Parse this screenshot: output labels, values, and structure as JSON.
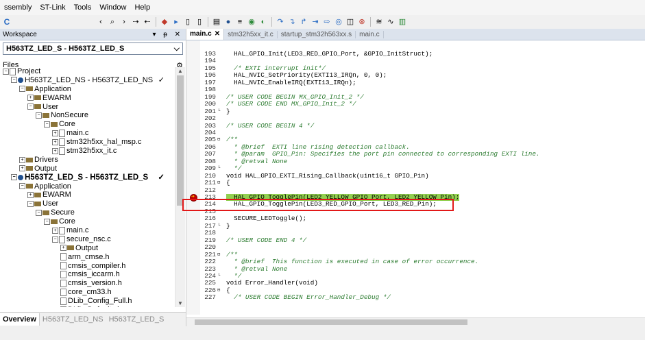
{
  "menu": [
    "ssembly",
    "ST-Link",
    "Tools",
    "Window",
    "Help"
  ],
  "toolbar": {
    "app_icon": "C",
    "icons": [
      "chevron-left-icon",
      "search-icon",
      "chevron-right-icon",
      "bookmark-next-icon",
      "bookmark-prev-icon",
      "stop-icon",
      "run-icon",
      "file-icon",
      "file-icon",
      "compile-icon",
      "build-icon",
      "build-all-icon",
      "make-icon",
      "debug-icon",
      "step-over-icon",
      "step-into-icon",
      "step-out-icon",
      "next-stmt-icon",
      "run-to-cursor-icon",
      "reset-icon",
      "break-icon",
      "stop-debug-icon",
      "etm-icon",
      "swo-icon",
      "chart-icon"
    ]
  },
  "workspace": {
    "title": "Workspace",
    "header_controls": "▾ ᵽ ✕",
    "selected_config": "H563TZ_LED_S - H563TZ_LED_S",
    "files_label": "Files",
    "tree": [
      {
        "indent": 0,
        "prefix": "⊟",
        "icon": "file",
        "label": "Project"
      },
      {
        "indent": 1,
        "prefix": "⊟",
        "icon": "proj",
        "label": "H563TZ_LED_NS - H563TZ_LED_NS",
        "check": "✓"
      },
      {
        "indent": 2,
        "prefix": "⊟",
        "icon": "folder",
        "label": "Application"
      },
      {
        "indent": 3,
        "prefix": "⊞",
        "icon": "folder",
        "label": "EWARM"
      },
      {
        "indent": 3,
        "prefix": "⊟",
        "icon": "folder",
        "label": "User"
      },
      {
        "indent": 4,
        "prefix": "⊟",
        "icon": "folder",
        "label": "NonSecure"
      },
      {
        "indent": 5,
        "prefix": "⊟",
        "icon": "folder",
        "label": "Core"
      },
      {
        "indent": 6,
        "prefix": "⊞",
        "icon": "file",
        "label": "main.c"
      },
      {
        "indent": 6,
        "prefix": "⊞",
        "icon": "file",
        "label": "stm32h5xx_hal_msp.c"
      },
      {
        "indent": 6,
        "prefix": "⊞",
        "icon": "file",
        "label": "stm32h5xx_it.c"
      },
      {
        "indent": 2,
        "prefix": "⊞",
        "icon": "folder",
        "label": "Drivers"
      },
      {
        "indent": 2,
        "prefix": "⊞",
        "icon": "folder",
        "label": "Output"
      },
      {
        "indent": 1,
        "prefix": "⊟",
        "icon": "proj",
        "label": "H563TZ_LED_S - H563TZ_LED_S",
        "check": "✓",
        "bold": true
      },
      {
        "indent": 2,
        "prefix": "⊟",
        "icon": "folder",
        "label": "Application"
      },
      {
        "indent": 3,
        "prefix": "⊞",
        "icon": "folder",
        "label": "EWARM"
      },
      {
        "indent": 3,
        "prefix": "⊟",
        "icon": "folder",
        "label": "User"
      },
      {
        "indent": 4,
        "prefix": "⊟",
        "icon": "folder",
        "label": "Secure"
      },
      {
        "indent": 5,
        "prefix": "⊟",
        "icon": "folder",
        "label": "Core"
      },
      {
        "indent": 6,
        "prefix": "⊞",
        "icon": "file",
        "label": "main.c"
      },
      {
        "indent": 6,
        "prefix": "⊟",
        "icon": "file",
        "label": "secure_nsc.c"
      },
      {
        "indent": 7,
        "prefix": "⊞",
        "icon": "folder",
        "label": "Output"
      },
      {
        "indent": 7,
        "prefix": "",
        "icon": "file",
        "label": "arm_cmse.h"
      },
      {
        "indent": 7,
        "prefix": "",
        "icon": "file",
        "label": "cmsis_compiler.h"
      },
      {
        "indent": 7,
        "prefix": "",
        "icon": "file",
        "label": "cmsis_iccarm.h"
      },
      {
        "indent": 7,
        "prefix": "",
        "icon": "file",
        "label": "cmsis_version.h"
      },
      {
        "indent": 7,
        "prefix": "",
        "icon": "file",
        "label": "core_cm33.h"
      },
      {
        "indent": 7,
        "prefix": "",
        "icon": "file",
        "label": "DLib_Config_Full.h"
      },
      {
        "indent": 7,
        "prefix": "",
        "icon": "file",
        "label": "DLib_Defaults.h"
      }
    ],
    "bottom_tabs": [
      "Overview",
      "H563TZ_LED_NS",
      "H563TZ_LED_S"
    ]
  },
  "editor": {
    "tabs": [
      {
        "label": "main.c",
        "close": "✕",
        "active": true
      },
      {
        "label": "stm32h5xx_it.c"
      },
      {
        "label": "startup_stm32h563xx.s"
      },
      {
        "label": "main.c"
      }
    ],
    "lines": [
      {
        "n": "193",
        "fold": "",
        "t": "  HAL_GPIO_Init(LED3_RED_GPIO_Port, &GPIO_InitStruct);"
      },
      {
        "n": "194",
        "fold": "",
        "t": ""
      },
      {
        "n": "195",
        "fold": "",
        "t": "  /* EXTI interrupt init*/",
        "c": true
      },
      {
        "n": "196",
        "fold": "",
        "t": "  HAL_NVIC_SetPriority(EXTI13_IRQn, 0, 0);"
      },
      {
        "n": "197",
        "fold": "",
        "t": "  HAL_NVIC_EnableIRQ(EXTI13_IRQn);"
      },
      {
        "n": "198",
        "fold": "",
        "t": ""
      },
      {
        "n": "199",
        "fold": "",
        "t": "/* USER CODE BEGIN MX_GPIO_Init_2 */",
        "c": true
      },
      {
        "n": "200",
        "fold": "",
        "t": "/* USER CODE END MX_GPIO_Init_2 */",
        "c": true
      },
      {
        "n": "201",
        "fold": "└",
        "t": "}"
      },
      {
        "n": "202",
        "fold": "",
        "t": ""
      },
      {
        "n": "203",
        "fold": "",
        "t": "/* USER CODE BEGIN 4 */",
        "c": true
      },
      {
        "n": "204",
        "fold": "",
        "t": ""
      },
      {
        "n": "205",
        "fold": "⊟",
        "t": "/**",
        "c": true
      },
      {
        "n": "206",
        "fold": "",
        "t": "  * @brief  EXTI line rising detection callback.",
        "c": true
      },
      {
        "n": "207",
        "fold": "",
        "t": "  * @param  GPIO_Pin: Specifies the port pin connected to corresponding EXTI line.",
        "c": true
      },
      {
        "n": "208",
        "fold": "",
        "t": "  * @retval None",
        "c": true
      },
      {
        "n": "209",
        "fold": "└",
        "t": "  */",
        "c": true
      },
      {
        "n": "210",
        "fold": "",
        "t": "void HAL_GPIO_EXTI_Rising_Callback(uint16_t GPIO_Pin)"
      },
      {
        "n": "211",
        "fold": "⊟",
        "t": "{"
      },
      {
        "n": "212",
        "fold": "",
        "t": ""
      },
      {
        "n": "213",
        "fold": "",
        "t": "  HAL_GPIO_TogglePin(LED2_YELLOW_GPIO_Port, LED2_YELLOW_Pin);",
        "hl": true,
        "bp": true
      },
      {
        "n": "214",
        "fold": "",
        "t": "  HAL_GPIO_TogglePin(LED3_RED_GPIO_Port, LED3_RED_Pin);"
      },
      {
        "n": "215",
        "fold": "",
        "t": ""
      },
      {
        "n": "216",
        "fold": "",
        "t": "  SECURE_LEDToggle();"
      },
      {
        "n": "217",
        "fold": "└",
        "t": "}"
      },
      {
        "n": "218",
        "fold": "",
        "t": ""
      },
      {
        "n": "219",
        "fold": "",
        "t": "/* USER CODE END 4 */",
        "c": true
      },
      {
        "n": "220",
        "fold": "",
        "t": ""
      },
      {
        "n": "221",
        "fold": "⊟",
        "t": "/**",
        "c": true
      },
      {
        "n": "222",
        "fold": "",
        "t": "  * @brief  This function is executed in case of error occurrence.",
        "c": true
      },
      {
        "n": "223",
        "fold": "",
        "t": "  * @retval None",
        "c": true
      },
      {
        "n": "224",
        "fold": "└",
        "t": "  */",
        "c": true
      },
      {
        "n": "225",
        "fold": "",
        "t": "void Error_Handler(void)"
      },
      {
        "n": "226",
        "fold": "⊟",
        "t": "{"
      },
      {
        "n": "227",
        "fold": "",
        "t": "  /* USER CODE BEGIN Error_Handler_Debug */",
        "c": true
      }
    ]
  }
}
